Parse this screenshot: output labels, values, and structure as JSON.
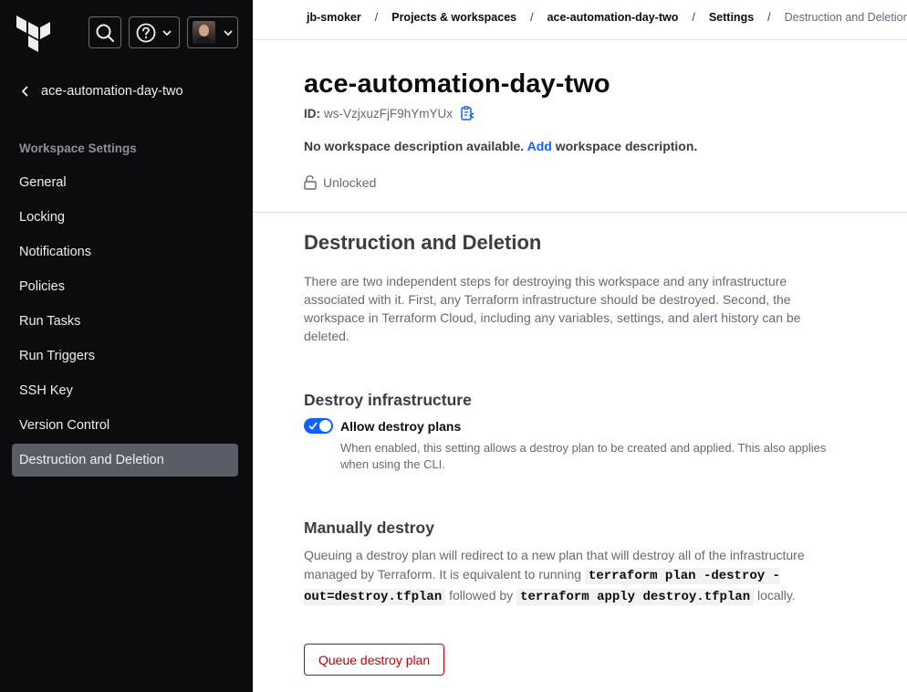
{
  "sidebar": {
    "back_label": "ace-automation-day-two",
    "section_title": "Workspace Settings",
    "items": [
      {
        "label": "General"
      },
      {
        "label": "Locking"
      },
      {
        "label": "Notifications"
      },
      {
        "label": "Policies"
      },
      {
        "label": "Run Tasks"
      },
      {
        "label": "Run Triggers"
      },
      {
        "label": "SSH Key"
      },
      {
        "label": "Version Control"
      },
      {
        "label": "Destruction and Deletion",
        "active": true
      }
    ],
    "icons": {
      "logo": "terraform-logo",
      "search": "search-icon",
      "help": "help-icon",
      "user": "user-avatar"
    }
  },
  "breadcrumb": [
    "jb-smoker",
    "Projects & workspaces",
    "ace-automation-day-two",
    "Settings",
    "Destruction and Deletion"
  ],
  "workspace": {
    "name": "ace-automation-day-two",
    "id_label": "ID:",
    "id_value": "ws-VzjxuzFjF9hYmYUx",
    "desc_prefix": "No workspace description available.",
    "desc_link": "Add",
    "desc_suffix": "workspace description.",
    "lock_status": "Unlocked"
  },
  "content": {
    "title": "Destruction and Deletion",
    "intro": "There are two independent steps for destroying this workspace and any infrastructure associated with it. First, any Terraform infrastructure should be destroyed. Second, the workspace in Terraform Cloud, including any variables, settings, and alert history can be deleted.",
    "destroy_infra": {
      "heading": "Destroy infrastructure",
      "toggle_label": "Allow destroy plans",
      "toggle_on": true,
      "help": "When enabled, this setting allows a destroy plan to be created and applied. This also applies when using the CLI."
    },
    "manual": {
      "heading": "Manually destroy",
      "text_1": "Queuing a destroy plan will redirect to a new plan that will destroy all of the infrastructure managed by Terraform. It is equivalent to running",
      "code_1": "terraform plan -destroy -out=destroy.tfplan",
      "text_2": "followed by",
      "code_2": "terraform apply destroy.tfplan",
      "text_3": "locally.",
      "button_label": "Queue destroy plan"
    }
  },
  "colors": {
    "sidebar_bg": "#0c0c0e",
    "accent": "#1060ff",
    "danger": "#c00005"
  }
}
